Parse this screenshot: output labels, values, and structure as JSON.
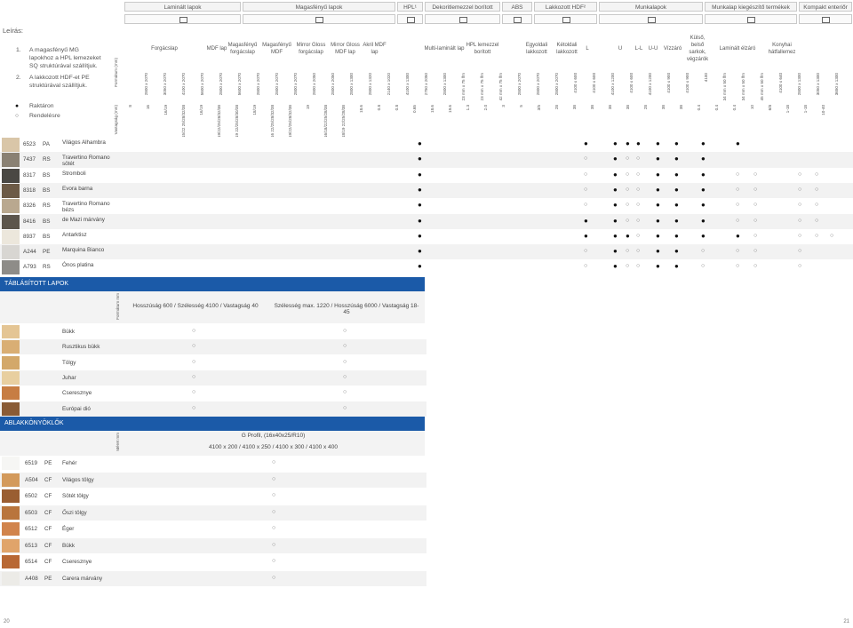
{
  "legend": {
    "title": "Leírás:",
    "note1_num": "1.",
    "note1": "A magasfényű MG lapokhoz a HPL lemezeket SQ struktúrával szállítjuk.",
    "note2_num": "2.",
    "note2": "A lakkozott HDF-et PE struktúrával szállítjuk.",
    "stock_symbol": "●",
    "stock_label": "Raktáron",
    "order_symbol": "○",
    "order_label": "Rendelésre",
    "format_label": "Formátum (mm)",
    "thickness_label": "Vastagság (mm)"
  },
  "groups": [
    {
      "label": "Laminált lapok"
    },
    {
      "label": "Magasfényű lapok"
    },
    {
      "label": "HPL¹"
    },
    {
      "label": "Dekoritlemezzel borított lapok¹"
    },
    {
      "label": "ABS élzáró"
    },
    {
      "label": "Lakkozott HDF²"
    },
    {
      "label": "Munkalapok"
    },
    {
      "label": "Munkalap kiegészítő termékek"
    },
    {
      "label": "Kompakt enteriőr"
    }
  ],
  "subheads": [
    "Forgácslap",
    "MDF lap",
    "Magasfényű forgácslap",
    "Magasfényű MDF",
    "Mirror Gloss forgácslap",
    "Mirror Gloss MDF lap",
    "Akril MDF lap",
    "Multi-laminált lap",
    "HPL lemezzel borított",
    "Egyoldali lakkozott",
    "Kétoldali lakkozott",
    "L",
    "U",
    "L-L",
    "U-U",
    "Vízzáró",
    "Külső, belső sarkok, végzárók",
    "Laminált élzáró",
    "Konyhai hátfallemez"
  ],
  "formats": [
    "2800 x 2070",
    "3050 x 2070",
    "4100 x 2070",
    "5600 x 2070",
    "2800 x 2070",
    "5600 x 2070",
    "2800 x 2070",
    "2800 x 2070",
    "2800 x 2070",
    "2800 x 2050",
    "2800 x 2050",
    "2800 x 1300",
    "2800 x 1320",
    "2140 x 1020",
    "4100 x 1300",
    "2750 x 2050",
    "2800 x 1300",
    "23 mm x 75 lfm",
    "23 mm x 75 lfm",
    "42 mm x 75 lfm",
    "2800 x 2070",
    "2800 x 2070",
    "2800 x 2070",
    "4100 x 600",
    "4100 x 600",
    "4100 x 1200",
    "4100 x 600",
    "4100 x 1200",
    "4100 x 900",
    "4100 x 900",
    "4100",
    "34 mm x 50 lfm",
    "34 mm x 50 lfm",
    "45 mm x 50 lfm",
    "4100 x 640",
    "2800 x 1300",
    "3050 x 1300",
    "3650 x 1300"
  ],
  "thicknesses": [
    "8",
    "16",
    "16/19",
    "10/12/15/22 25/28/32/38",
    "16/19",
    "8/10/12/15/16/18 19/22/25/28/32/38",
    "8/10/12/15/16/19 22/25/28/30/38",
    "18/19",
    "8/10/12/15/16 22/25/28/32/38",
    "8/10/12/15/16/18 19/22/25/28/32/38",
    "19",
    "16/18/22/25/28/38",
    "16/18/19 22/25/28/38",
    "18.6",
    "0.8",
    "0.8",
    "0.65",
    "18.6",
    "19.6",
    "1.3",
    "2.0",
    "3",
    "5",
    "3/5",
    "28",
    "38",
    "38",
    "38",
    "38",
    "28",
    "38",
    "38",
    "0.4",
    "0.4",
    "0.4",
    "10",
    "6/8",
    "1-18",
    "1-18",
    "10-40"
  ],
  "products": [
    {
      "code": "6523",
      "finish": "PA",
      "name": "Világos Alhambra",
      "sw": "#d9c6a8",
      "marks": [
        "●",
        "●",
        "●",
        "●",
        "●",
        "●",
        "●",
        "●",
        "●"
      ]
    },
    {
      "code": "7437",
      "finish": "RS",
      "name": "Travertino Romano sötét",
      "sw": "#8a8173",
      "marks": [
        "●",
        "○",
        "●",
        "○",
        "○",
        "●",
        "●",
        "●"
      ]
    },
    {
      "code": "8317",
      "finish": "BS",
      "name": "Stromboli",
      "sw": "#4a4844",
      "marks": [
        "●",
        "○",
        "●",
        "○",
        "○",
        "●",
        "●",
        "●",
        "○",
        "○",
        "○",
        "○"
      ]
    },
    {
      "code": "8318",
      "finish": "BS",
      "name": "Evora barna",
      "sw": "#6c5a46",
      "marks": [
        "●",
        "○",
        "●",
        "○",
        "○",
        "●",
        "●",
        "●",
        "○",
        "○",
        "○",
        "○"
      ]
    },
    {
      "code": "8326",
      "finish": "RS",
      "name": "Travertino Romano bézs",
      "sw": "#b9a88f",
      "marks": [
        "●",
        "○",
        "●",
        "○",
        "○",
        "●",
        "●",
        "●",
        "○",
        "○",
        "○",
        "○"
      ]
    },
    {
      "code": "8416",
      "finish": "BS",
      "name": "de Mazi márvány",
      "sw": "#5c554c",
      "marks": [
        "●",
        "●",
        "●",
        "○",
        "○",
        "●",
        "●",
        "●",
        "○",
        "○",
        "○",
        "○"
      ]
    },
    {
      "code": "8937",
      "finish": "BS",
      "name": "Antarktisz",
      "sw": "#ece7dc",
      "marks": [
        "●",
        "●",
        "●",
        "●",
        "○",
        "●",
        "●",
        "●",
        "●",
        "○",
        "○",
        "○",
        "○"
      ]
    },
    {
      "code": "A244",
      "finish": "PE",
      "name": "Marquina Bianco",
      "sw": "#d8d6d2",
      "marks": [
        "●",
        "○",
        "●",
        "○",
        "○",
        "●",
        "●",
        "○",
        "○",
        "○",
        "○"
      ]
    },
    {
      "code": "A793",
      "finish": "RS",
      "name": "Ónos platina",
      "sw": "#8e8c88",
      "marks": [
        "●",
        "○",
        "●",
        "○",
        "○",
        "●",
        "●",
        "○",
        "○",
        "○",
        "○"
      ]
    }
  ],
  "tables": {
    "title": "TÁBLÁSÍTOTT LAPOK",
    "format_label": "Formátum mm",
    "col1": "Hosszúság 600 / Szélesség 4100 / Vastagság 40",
    "col2": "Szélesség max. 1220 / Hosszúság 6000 / Vastagság 18-45",
    "items": [
      {
        "name": "Bükk",
        "sw": "#e4c594",
        "m1": "○",
        "m2": "○"
      },
      {
        "name": "Rusztikus bükk",
        "sw": "#d9ae74",
        "m1": "○",
        "m2": "○"
      },
      {
        "name": "Tölgy",
        "sw": "#d3a86a",
        "m1": "○",
        "m2": "○"
      },
      {
        "name": "Juhar",
        "sw": "#e8cfa0",
        "m1": "○",
        "m2": "○"
      },
      {
        "name": "Cseresznye",
        "sw": "#c77d43",
        "m1": "○",
        "m2": "○"
      },
      {
        "name": "Európai dió",
        "sw": "#8a5b35",
        "m1": "○",
        "m2": "○"
      }
    ]
  },
  "sills": {
    "title": "ABLAKKÖNYÖKLŐK",
    "size_label": "Méret mm",
    "profile": "G Profil, (16x40x25/R10)",
    "sizes": "4100 x 200 / 4100 x 250 / 4100 x 300 / 4100 x 400",
    "items": [
      {
        "code": "6519",
        "finish": "PE",
        "name": "Fehér",
        "sw": "#f6f6f4",
        "m": "○"
      },
      {
        "code": "A504",
        "finish": "CF",
        "name": "Világos tölgy",
        "sw": "#d39a5c",
        "m": "○"
      },
      {
        "code": "6502",
        "finish": "CF",
        "name": "Sötét tölgy",
        "sw": "#9a5e32",
        "m": "○"
      },
      {
        "code": "6503",
        "finish": "CF",
        "name": "Őszi tölgy",
        "sw": "#b9753d",
        "m": "○"
      },
      {
        "code": "6512",
        "finish": "CF",
        "name": "Éger",
        "sw": "#d1844c",
        "m": "○"
      },
      {
        "code": "6513",
        "finish": "CF",
        "name": "Bükk",
        "sw": "#e0a46a",
        "m": "○"
      },
      {
        "code": "6514",
        "finish": "CF",
        "name": "Cseresznye",
        "sw": "#b86834",
        "m": "○"
      },
      {
        "code": "A408",
        "finish": "PE",
        "name": "Carera márvány",
        "sw": "#ecebe7",
        "m": "○"
      }
    ]
  },
  "pages": {
    "left": "20",
    "right": "21"
  }
}
